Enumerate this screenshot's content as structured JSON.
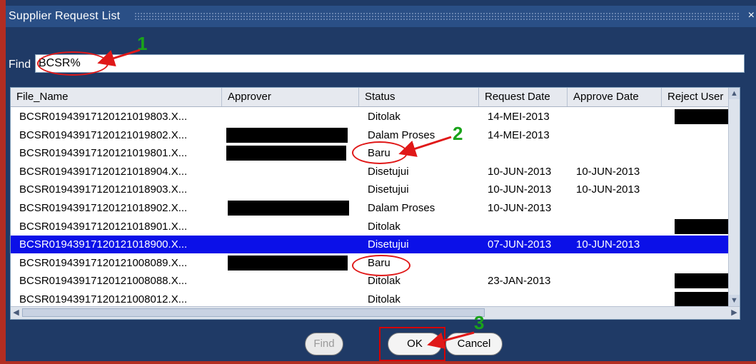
{
  "window": {
    "title": "Supplier Request List",
    "close_glyph": "×"
  },
  "find": {
    "label": "Find",
    "value": "BCSR%"
  },
  "table": {
    "columns": [
      "File_Name",
      "Approver",
      "Status",
      "Request Date",
      "Approve Date",
      "Reject User"
    ],
    "rows": [
      {
        "file": "BCSR01943917120121019803.X...",
        "status": "Ditolak",
        "request_date": "14-MEI-2013",
        "approve_date": ""
      },
      {
        "file": "BCSR01943917120121019802.X...",
        "status": "Dalam Proses",
        "request_date": "14-MEI-2013",
        "approve_date": ""
      },
      {
        "file": "BCSR01943917120121019801.X...",
        "status": "Baru",
        "request_date": "",
        "approve_date": ""
      },
      {
        "file": "BCSR01943917120121018904.X...",
        "status": "Disetujui",
        "request_date": "10-JUN-2013",
        "approve_date": "10-JUN-2013"
      },
      {
        "file": "BCSR01943917120121018903.X...",
        "status": "Disetujui",
        "request_date": "10-JUN-2013",
        "approve_date": "10-JUN-2013"
      },
      {
        "file": "BCSR01943917120121018902.X...",
        "status": "Dalam Proses",
        "request_date": "10-JUN-2013",
        "approve_date": ""
      },
      {
        "file": "BCSR01943917120121018901.X...",
        "status": "Ditolak",
        "request_date": "",
        "approve_date": ""
      },
      {
        "file": "BCSR01943917120121018900.X...",
        "status": "Disetujui",
        "request_date": "07-JUN-2013",
        "approve_date": "10-JUN-2013"
      },
      {
        "file": "BCSR01943917120121008089.X...",
        "status": "Baru",
        "request_date": "",
        "approve_date": ""
      },
      {
        "file": "BCSR01943917120121008088.X...",
        "status": "Ditolak",
        "request_date": "23-JAN-2013",
        "approve_date": ""
      },
      {
        "file": "BCSR01943917120121008012.X...",
        "status": "Ditolak",
        "request_date": "",
        "approve_date": ""
      }
    ]
  },
  "buttons": {
    "find": "Find",
    "ok": "OK",
    "cancel": "Cancel"
  },
  "annotations": {
    "one": "1",
    "two": "2",
    "three": "3"
  },
  "colors": {
    "selection": "#0b10e8",
    "annotation_red": "#e01818",
    "annotation_green": "#1aa31a"
  }
}
